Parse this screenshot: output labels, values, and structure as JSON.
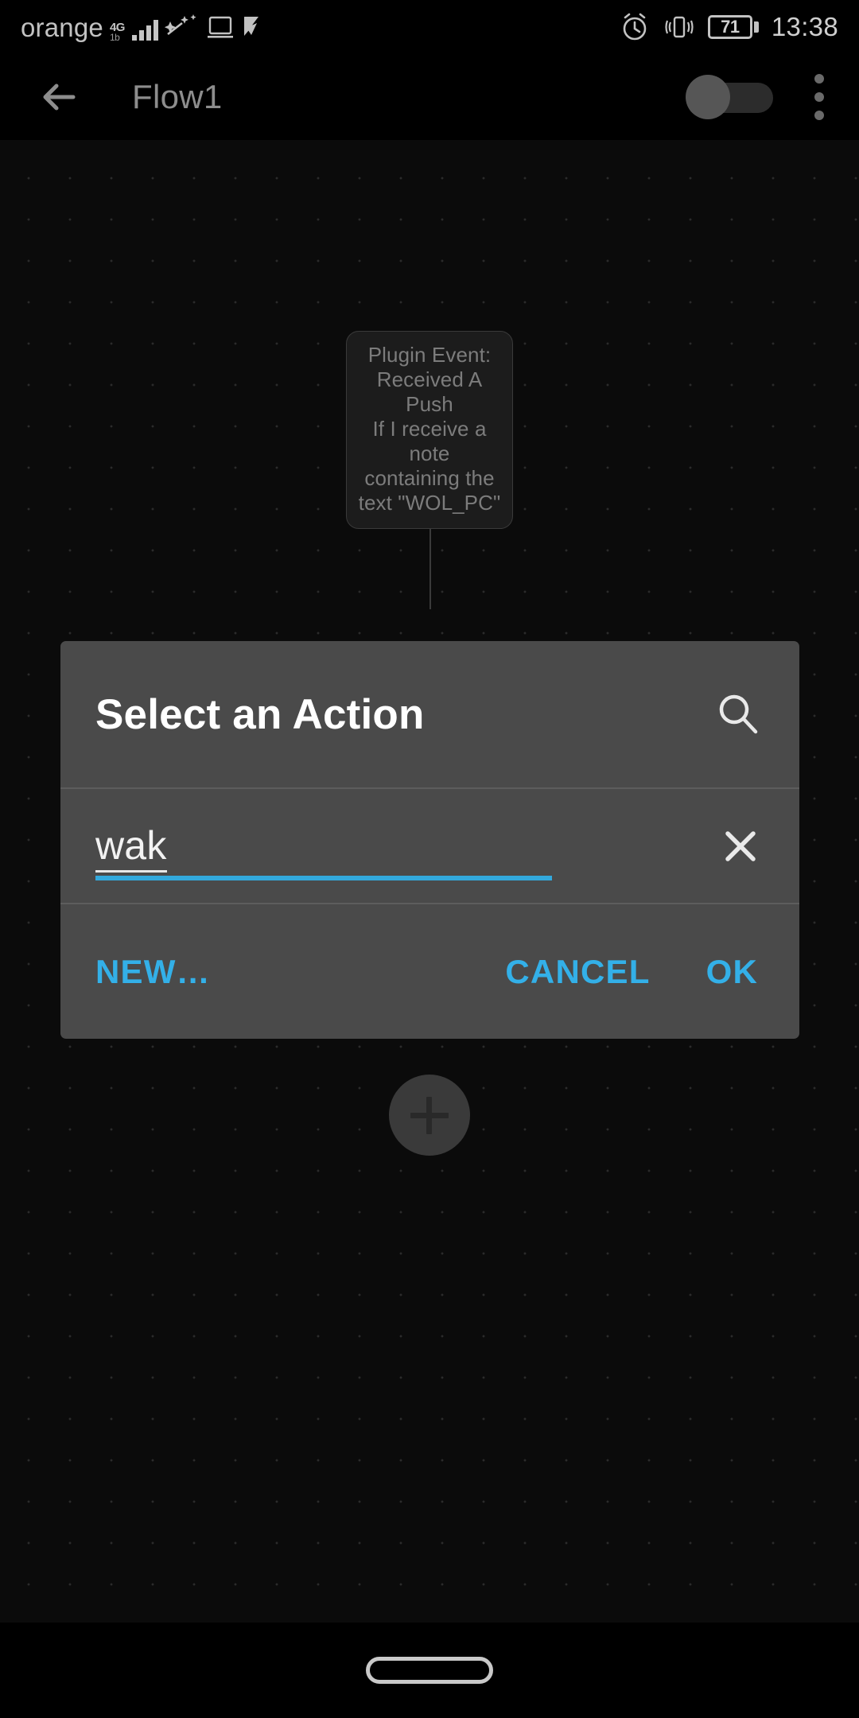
{
  "status_bar": {
    "carrier": "orange",
    "network_type": "4G",
    "network_sub": "1b",
    "signal_bars": 4,
    "icons": [
      "magic-wand-icon",
      "cast-screen-icon",
      "play-store-icon",
      "alarm-icon",
      "vibrate-icon"
    ],
    "battery_percent": "71",
    "time": "13:38"
  },
  "app_bar": {
    "back_label": "back-arrow",
    "title": "Flow1",
    "toggle_state": "off",
    "overflow_label": "more-options"
  },
  "canvas": {
    "node": {
      "lines": [
        "Plugin Event:",
        "Received A Push",
        "If I receive a note",
        "containing the",
        "text \"WOL_PC\""
      ]
    },
    "add_button_label": "+"
  },
  "dialog": {
    "title": "Select an Action",
    "search_icon": "search-icon",
    "input": {
      "value": "wak",
      "placeholder": "",
      "clear_icon": "close-icon"
    },
    "buttons": {
      "new": "NEW…",
      "cancel": "CANCEL",
      "ok": "OK"
    }
  },
  "nav_bar": {
    "gesture_pill": "home-pill"
  },
  "colors": {
    "accent": "#33b0e8",
    "dialog_bg": "#4a4a4a",
    "canvas_bg": "#0b0b0b",
    "text_primary": "#ffffff",
    "text_muted": "#7c7c7c"
  }
}
